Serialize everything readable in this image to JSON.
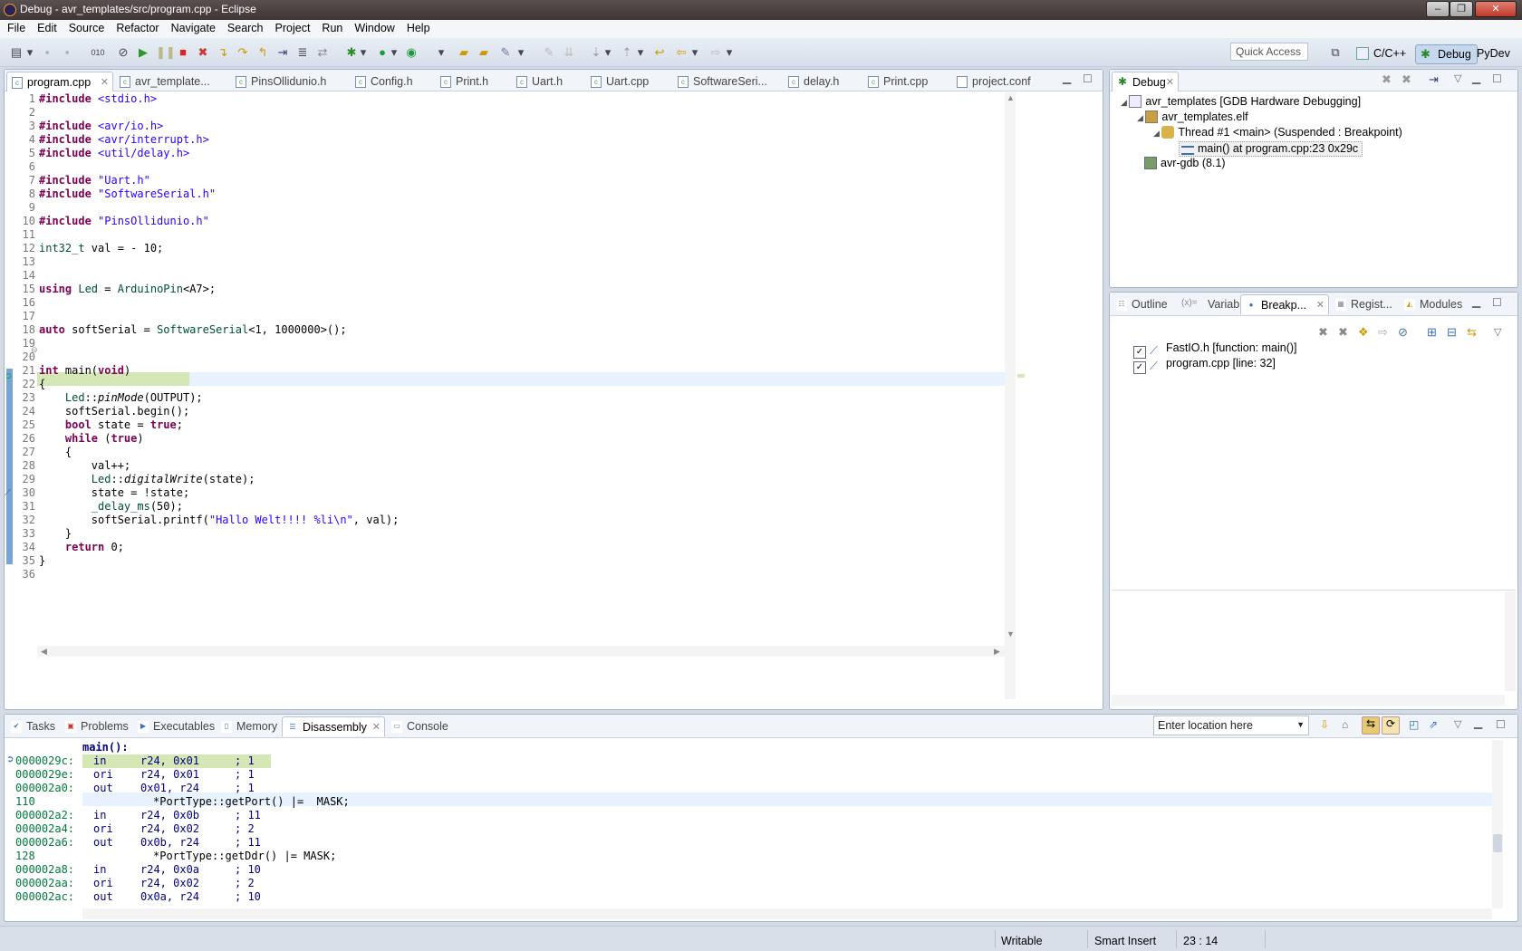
{
  "window": {
    "title": "Debug - avr_templates/src/program.cpp - Eclipse"
  },
  "menu": [
    "File",
    "Edit",
    "Source",
    "Refactor",
    "Navigate",
    "Search",
    "Project",
    "Run",
    "Window",
    "Help"
  ],
  "toolbar": {
    "quick_access": "Quick Access",
    "perspectives": [
      "C/C++",
      "Debug",
      "PyDev"
    ]
  },
  "editor": {
    "tabs": [
      "program.cpp",
      "avr_template...",
      "PinsOllidunio.h",
      "Config.h",
      "Print.h",
      "Uart.h",
      "Uart.cpp",
      "SoftwareSeri...",
      "delay.h",
      "Print.cpp",
      "project.conf"
    ],
    "line_numbers": [
      "1",
      "2",
      "3",
      "4",
      "5",
      "6",
      "7",
      "8",
      "9",
      "10",
      "11",
      "12",
      "13",
      "14",
      "15",
      "16",
      "17",
      "18",
      "19",
      "20",
      "21",
      "22",
      "23",
      "24",
      "25",
      "26",
      "27",
      "28",
      "29",
      "30",
      "31",
      "32",
      "33",
      "34",
      "35",
      "36"
    ],
    "current_line": 23,
    "breakpoint_line": 32
  },
  "debug_view": {
    "tab": "Debug",
    "tree": [
      "avr_templates [GDB Hardware Debugging]",
      "avr_templates.elf",
      "Thread #1 <main> (Suspended : Breakpoint)",
      "main() at program.cpp:23 0x29c",
      "avr-gdb (8.1)"
    ]
  },
  "breakpoints_view": {
    "tabs": [
      "Outline",
      "Variabl...",
      "Breakp...",
      "Regist...",
      "Modules"
    ],
    "items": [
      "FastIO.h [function: main()]",
      "program.cpp [line: 32]"
    ]
  },
  "bottom": {
    "tabs": [
      "Tasks",
      "Problems",
      "Executables",
      "Memory",
      "Disassembly",
      "Console"
    ],
    "location_placeholder": "Enter location here",
    "label": "main():",
    "rows": [
      {
        "addr": "0000029c:",
        "op": "in",
        "args": "r24, 0x01",
        "cmt": "; 1",
        "type": "ins"
      },
      {
        "addr": "0000029e:",
        "op": "ori",
        "args": "r24, 0x01",
        "cmt": "; 1",
        "type": "ins"
      },
      {
        "addr": "000002a0:",
        "op": "out",
        "args": "0x01, r24",
        "cmt": "; 1",
        "type": "ins"
      },
      {
        "addr": "110",
        "op": "",
        "args": "*PortType::getPort() |=  MASK;",
        "cmt": "",
        "type": "src"
      },
      {
        "addr": "000002a2:",
        "op": "in",
        "args": "r24, 0x0b",
        "cmt": "; 11",
        "type": "ins"
      },
      {
        "addr": "000002a4:",
        "op": "ori",
        "args": "r24, 0x02",
        "cmt": "; 2",
        "type": "ins"
      },
      {
        "addr": "000002a6:",
        "op": "out",
        "args": "0x0b, r24",
        "cmt": "; 11",
        "type": "ins"
      },
      {
        "addr": "128",
        "op": "",
        "args": "*PortType::getDdr() |= MASK;",
        "cmt": "",
        "type": "src"
      },
      {
        "addr": "000002a8:",
        "op": "in",
        "args": "r24, 0x0a",
        "cmt": "; 10",
        "type": "ins"
      },
      {
        "addr": "000002aa:",
        "op": "ori",
        "args": "r24, 0x02",
        "cmt": "; 2",
        "type": "ins"
      },
      {
        "addr": "000002ac:",
        "op": "out",
        "args": "0x0a, r24",
        "cmt": "; 10",
        "type": "ins"
      }
    ]
  },
  "status": {
    "writable": "Writable",
    "insert_mode": "Smart Insert",
    "position": "23 : 14"
  },
  "colors": {
    "accent": "#3d6fb6",
    "current_line": "#d4e7b5",
    "line_highlight": "#e8f2fe"
  }
}
